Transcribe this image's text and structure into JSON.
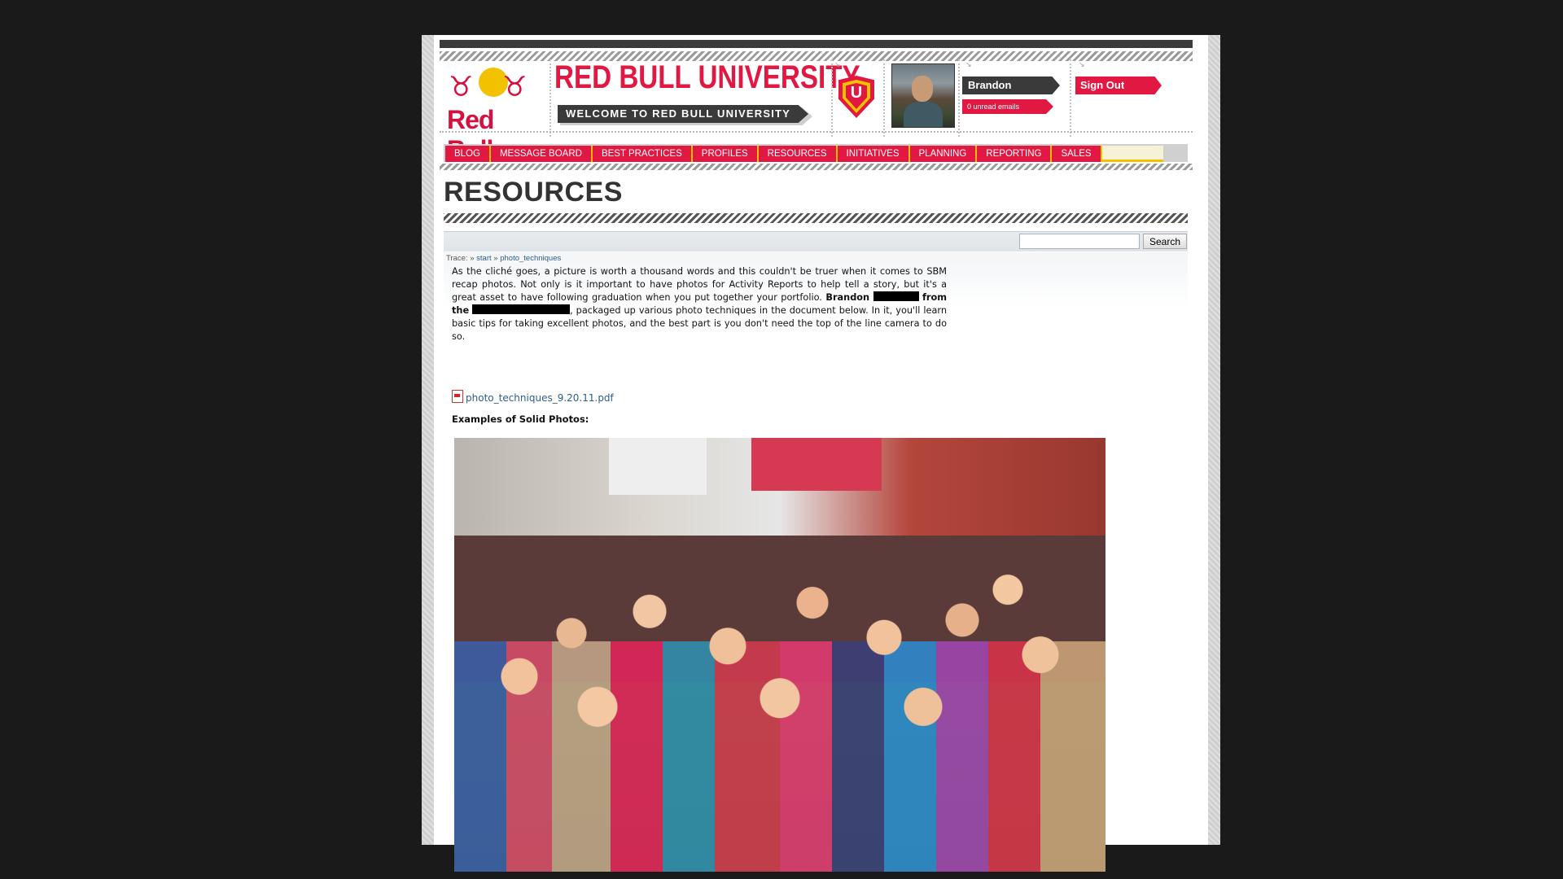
{
  "header": {
    "brand_text": "Red Bull",
    "site_title": "RED BULL UNIVERSITY",
    "welcome": "WELCOME TO RED BULL UNIVERSITY",
    "badge_letter": "U",
    "user_name": "Brandon",
    "emails": "0 unread emails",
    "signout": "Sign Out",
    "colors": {
      "accent": "#e11942",
      "gold": "#f2c200",
      "dark": "#3a3a3a"
    }
  },
  "nav": {
    "items": [
      "BLOG",
      "MESSAGE BOARD",
      "BEST PRACTICES",
      "PROFILES",
      "RESOURCES",
      "INITIATIVES",
      "PLANNING",
      "REPORTING",
      "SALES"
    ]
  },
  "page": {
    "heading": "RESOURCES"
  },
  "search": {
    "value": "",
    "button": "Search"
  },
  "trace": {
    "label": "Trace:",
    "sep": "»",
    "crumbs": [
      "start",
      "photo_techniques"
    ]
  },
  "content": {
    "p_part1": "As the cliché goes, a picture is worth a thousand words and this couldn't be truer when it comes to SBM recap photos. Not only is it important to have photos for Activity Reports to help tell a story, but it's a great asset to have following graduation when you put together your portfolio.",
    "p_name": "Brandon",
    "p_from": "from the",
    "p_part2": ", packaged up various photo techniques in the document below. In it, you'll learn basic tips for taking excellent photos, and the best part is you don't need the top of the line camera to do so.",
    "pdf_link": "photo_techniques_9.20.11.pdf",
    "examples_label": "Examples of Solid Photos:"
  }
}
